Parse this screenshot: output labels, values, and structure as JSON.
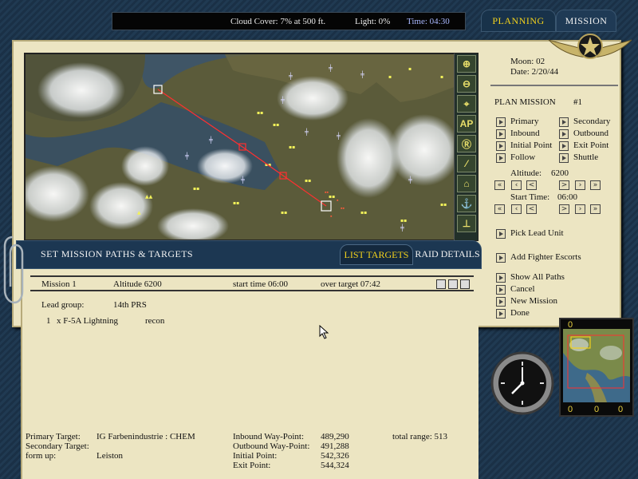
{
  "status": {
    "cloud_cover": "Cloud Cover:  7% at 500 ft.",
    "light": "Light:  0%",
    "time": "Time: 04:30"
  },
  "tabs": {
    "planning": "PLANNING",
    "mission": "MISSION"
  },
  "map_tools": [
    {
      "icon": "zoom-in-icon",
      "glyph": "⊕"
    },
    {
      "icon": "zoom-out-icon",
      "glyph": "⊖"
    },
    {
      "icon": "crosshair-icon",
      "glyph": "⌖"
    },
    {
      "icon": "ap-icon",
      "glyph": "AP"
    },
    {
      "icon": "r-icon",
      "glyph": "Ⓡ"
    },
    {
      "icon": "flak-icon",
      "glyph": "⁄"
    },
    {
      "icon": "factory-icon",
      "glyph": "⌂"
    },
    {
      "icon": "anchor-icon",
      "glyph": "⚓"
    },
    {
      "icon": "rail-icon",
      "glyph": "⊥"
    }
  ],
  "side": {
    "moon": "Moon:  02",
    "date": "Date:  2/20/44",
    "plan_title": "PLAN MISSION",
    "plan_number": "#1",
    "waypoints": [
      {
        "left": "Primary",
        "right": "Secondary"
      },
      {
        "left": "Inbound",
        "right": "Outbound"
      },
      {
        "left": "Initial Point",
        "right": "Exit Point"
      },
      {
        "left": "Follow",
        "right": "Shuttle"
      }
    ],
    "altitude_label": "Altitude:",
    "altitude_value": "6200",
    "start_time_label": "Start Time:",
    "start_time_value": "06:00",
    "stepper_glyphs": [
      "«",
      "‹",
      "<",
      ">",
      "›",
      "»"
    ],
    "pick_lead": "Pick Lead Unit",
    "add_escorts": "Add Fighter Escorts",
    "actions": [
      "Show All Paths",
      "Cancel",
      "New Mission",
      "Done"
    ]
  },
  "banner": {
    "title": "SET MISSION PATHS & TARGETS",
    "list_targets": "LIST TARGETS",
    "raid_details": "RAID DETAILS"
  },
  "details": {
    "mission": "Mission  1",
    "altitude": "Altitude 6200",
    "start_time": "start time  06:00",
    "over_target": "over target 07:42",
    "lead_group_label": "Lead group:",
    "lead_group_value": "14th PRS",
    "aircraft_count": "1",
    "aircraft_name": "x F-5A Lightning",
    "aircraft_role": "recon",
    "primary_target_label": "Primary Target:",
    "primary_target_value": "IG Farbenindustrie : CHEM",
    "secondary_target_label": "Secondary Target:",
    "secondary_target_value": "",
    "form_up_label": "form up:",
    "form_up_value": "Leiston",
    "inbound_label": "Inbound Way-Point:",
    "inbound_value": "489,290",
    "outbound_label": "Outbound Way-Point:",
    "outbound_value": "491,288",
    "initial_label": "Initial Point:",
    "initial_value": "542,326",
    "exit_label": "Exit Point:",
    "exit_value": "544,324",
    "total_range": "total range: 513"
  },
  "minimap": {
    "top_value": "0",
    "bottom_values": [
      "0",
      "0",
      "0"
    ]
  },
  "colors": {
    "accent_yellow": "#f2d11c",
    "panel_blue": "#1c3752",
    "paper": "#ece5c2",
    "route_red": "#ff3030"
  }
}
